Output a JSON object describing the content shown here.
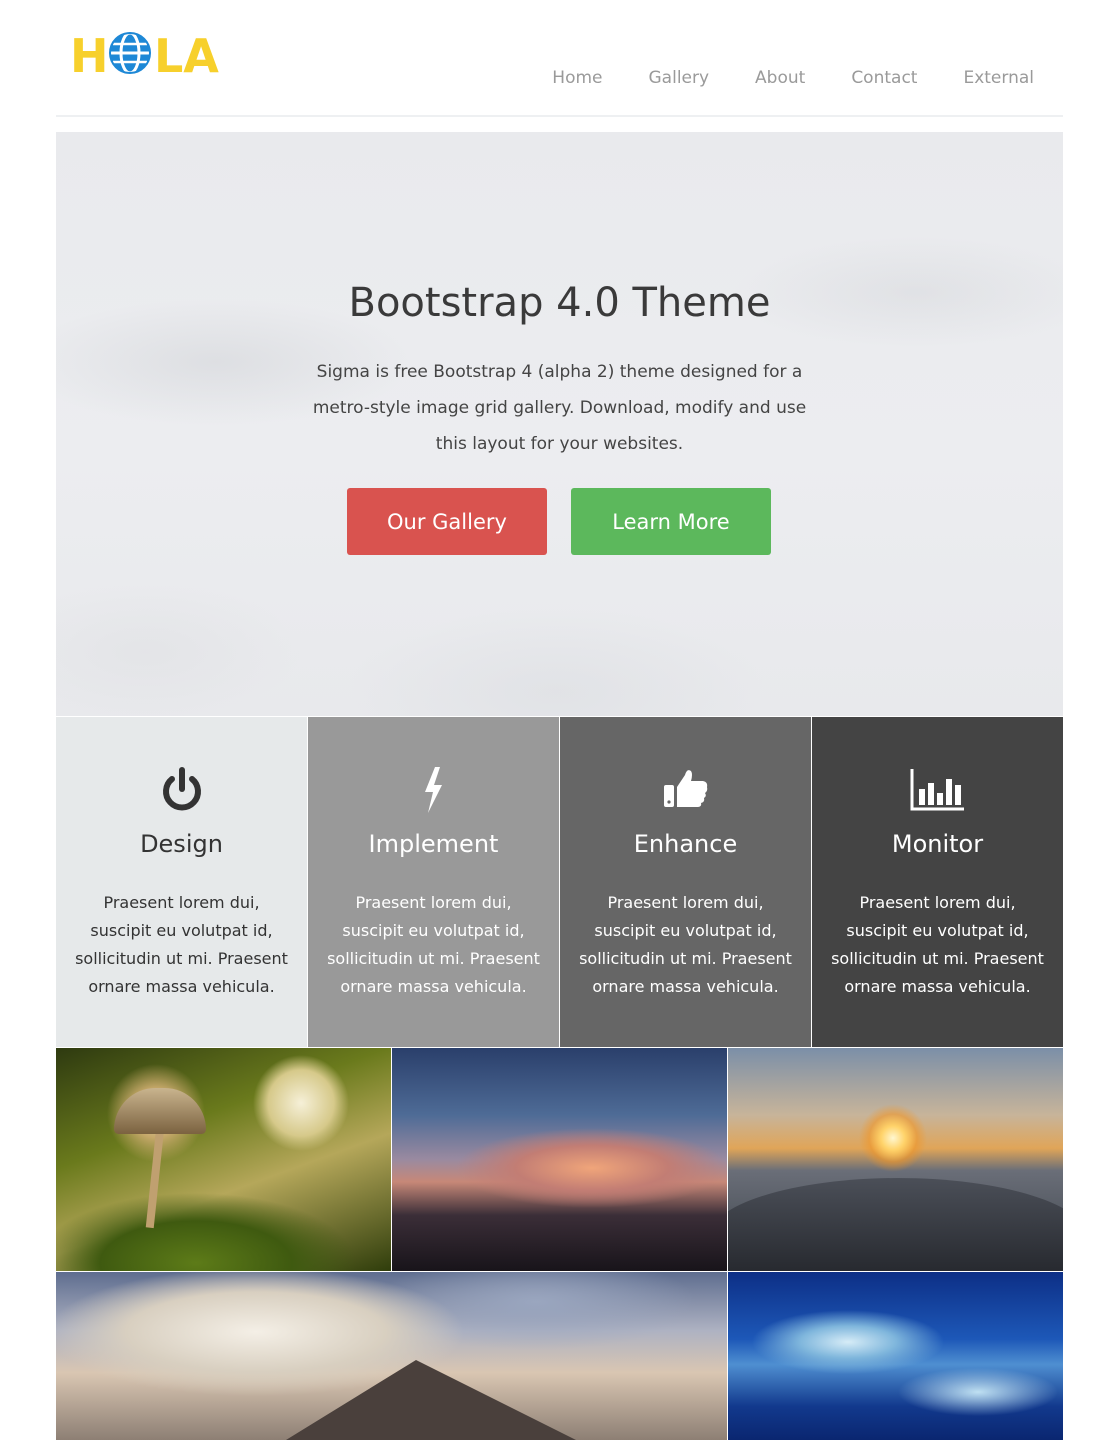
{
  "brand": {
    "logo_text": "HOLA",
    "accent": "#f7d02c",
    "globe_color": "#1e88d6"
  },
  "nav": [
    {
      "label": "Home"
    },
    {
      "label": "Gallery"
    },
    {
      "label": "About"
    },
    {
      "label": "Contact"
    },
    {
      "label": "External"
    }
  ],
  "hero": {
    "title": "Bootstrap 4.0 Theme",
    "text": "Sigma is free Bootstrap 4 (alpha 2) theme designed for a metro-style image grid gallery. Download, modify and use this layout for your websites.",
    "primary_button": "Our Gallery",
    "secondary_button": "Learn More",
    "primary_color": "#d9534f",
    "secondary_color": "#5cb85c"
  },
  "features": [
    {
      "icon": "power-icon",
      "title": "Design",
      "text": "Praesent lorem dui, suscipit eu volutpat id, sollicitudin ut mi. Praesent ornare massa vehicula."
    },
    {
      "icon": "bolt-icon",
      "title": "Implement",
      "text": "Praesent lorem dui, suscipit eu volutpat id, sollicitudin ut mi. Praesent ornare massa vehicula."
    },
    {
      "icon": "thumbs-up-icon",
      "title": "Enhance",
      "text": "Praesent lorem dui, suscipit eu volutpat id, sollicitudin ut mi. Praesent ornare massa vehicula."
    },
    {
      "icon": "bar-chart-icon",
      "title": "Monitor",
      "text": "Praesent lorem dui, suscipit eu volutpat id, sollicitudin ut mi. Praesent ornare massa vehicula."
    }
  ],
  "gallery": [
    {
      "subject": "mushroom"
    },
    {
      "subject": "sunset-clouds"
    },
    {
      "subject": "skatepark-sunset"
    },
    {
      "subject": "mountain-clouds"
    },
    {
      "subject": "ocean-waves"
    }
  ]
}
